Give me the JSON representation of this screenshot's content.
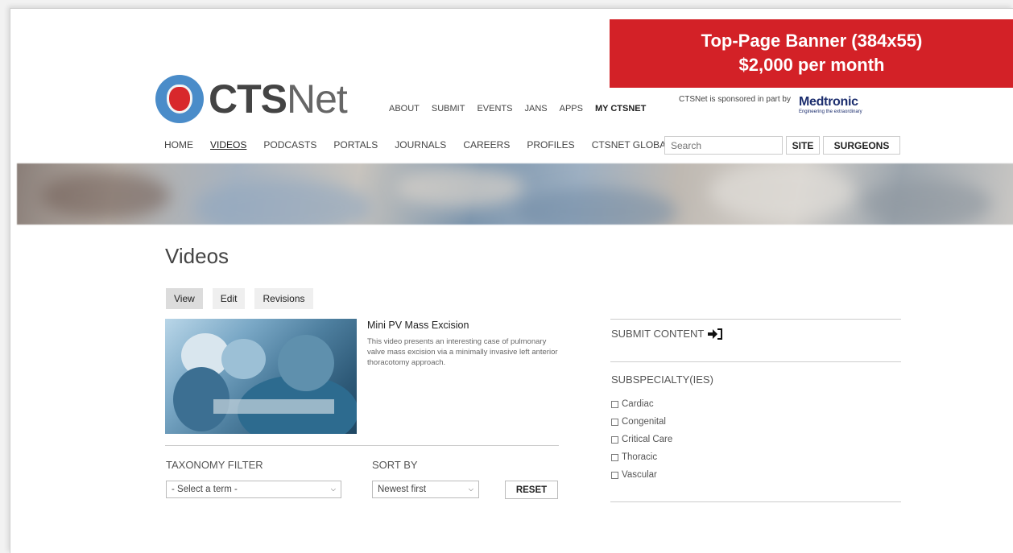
{
  "banner": {
    "line1": "Top-Page Banner (384x55)",
    "line2": "$2,000 per month"
  },
  "logo": {
    "bold": "CTS",
    "light": "Net"
  },
  "top_nav": [
    {
      "label": "ABOUT",
      "strong": false
    },
    {
      "label": "SUBMIT",
      "strong": false
    },
    {
      "label": "EVENTS",
      "strong": false
    },
    {
      "label": "JANS",
      "strong": false
    },
    {
      "label": "APPS",
      "strong": false
    },
    {
      "label": "MY CTSNET",
      "strong": true
    }
  ],
  "sponsor": {
    "text": "CTSNet is sponsored in part by",
    "brand": "Medtronic",
    "tagline": "Engineering the extraordinary"
  },
  "main_nav": [
    {
      "label": "HOME",
      "active": false
    },
    {
      "label": "VIDEOS",
      "active": true
    },
    {
      "label": "PODCASTS",
      "active": false
    },
    {
      "label": "PORTALS",
      "active": false
    },
    {
      "label": "JOURNALS",
      "active": false
    },
    {
      "label": "CAREERS",
      "active": false
    },
    {
      "label": "PROFILES",
      "active": false
    },
    {
      "label": "CTSNET GLOBAL",
      "active": false
    }
  ],
  "search": {
    "placeholder": "Search",
    "site_label": "SITE",
    "surgeons_label": "SURGEONS"
  },
  "page": {
    "title": "Videos"
  },
  "tabs": [
    {
      "label": "View",
      "active": true
    },
    {
      "label": "Edit",
      "active": false
    },
    {
      "label": "Revisions",
      "active": false
    }
  ],
  "video": {
    "title": "Mini PV Mass Excision",
    "description": "This video presents an interesting case of pulmonary valve mass excision via a minimally invasive left anterior thoracotomy approach."
  },
  "filters": {
    "taxonomy_label": "TAXONOMY FILTER",
    "taxonomy_value": "- Select a term -",
    "sort_label": "SORT BY",
    "sort_value": "Newest first",
    "reset_label": "RESET"
  },
  "sidebar": {
    "submit_label": "SUBMIT CONTENT",
    "subspecialty_label": "SUBSPECIALTY(IES)",
    "options": [
      "Cardiac",
      "Congenital",
      "Critical Care",
      "Thoracic",
      "Vascular"
    ]
  },
  "colors": {
    "banner": "#d32127",
    "logo_blue": "#4a8cc9",
    "logo_heart": "#d8282c",
    "medtronic": "#1c2e6e"
  }
}
